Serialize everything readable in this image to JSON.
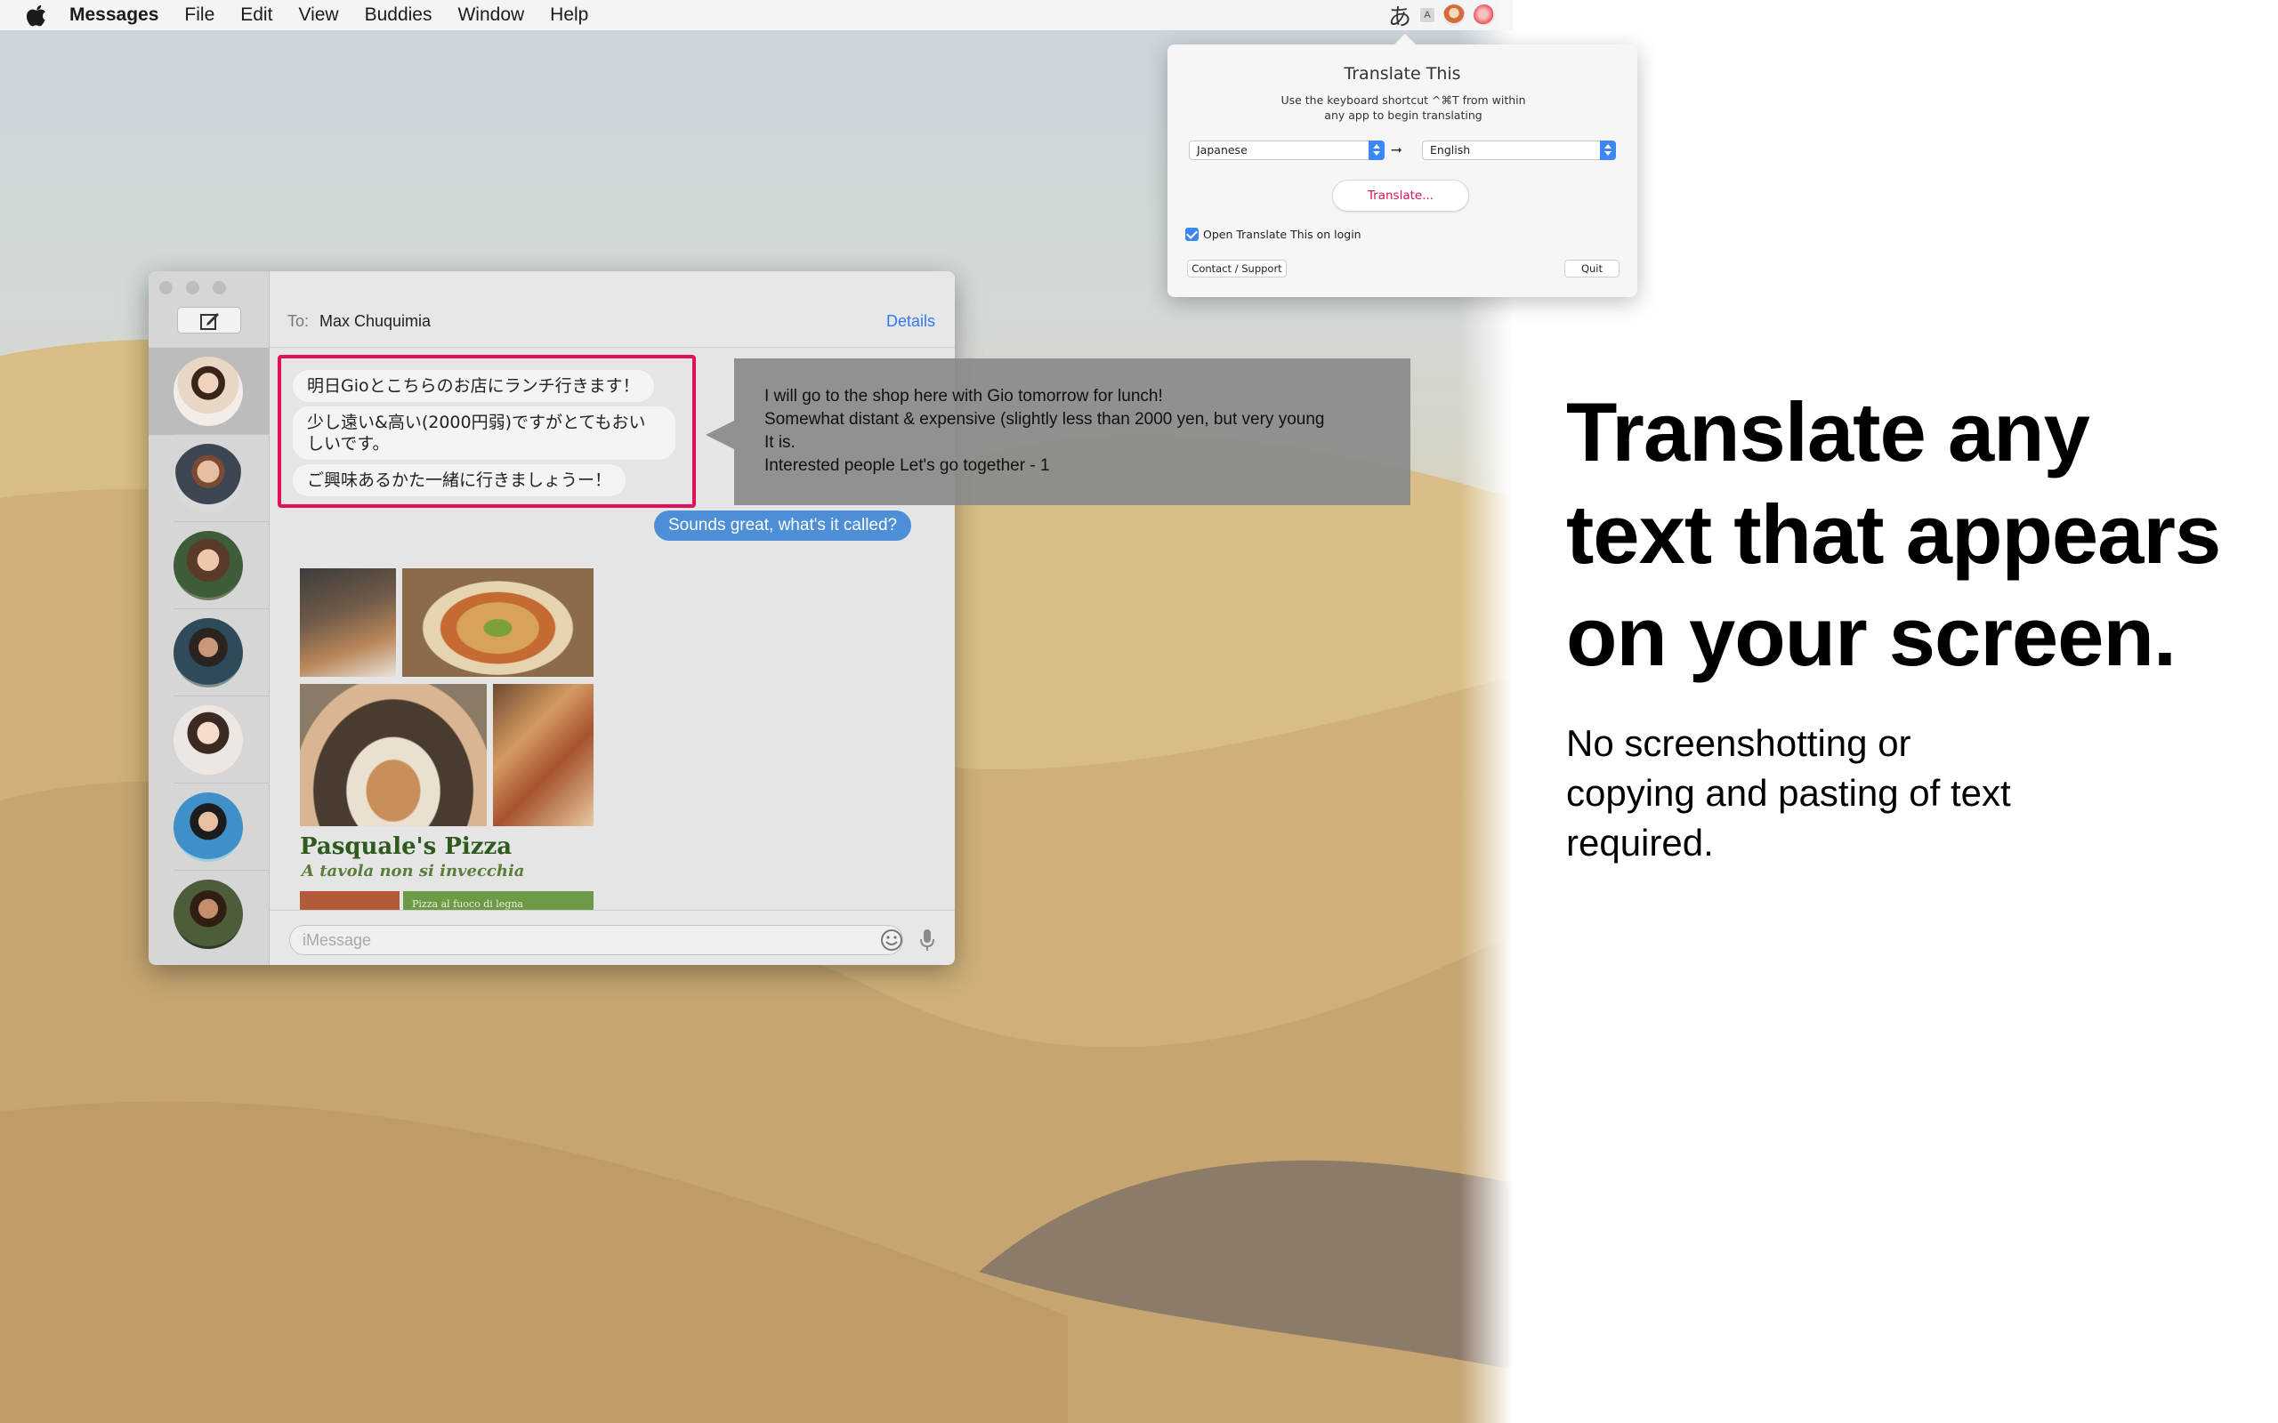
{
  "menubar": {
    "app_name": "Messages",
    "items": [
      "File",
      "Edit",
      "View",
      "Buddies",
      "Window",
      "Help"
    ],
    "status_glyph": "あ",
    "status_small_label": "A"
  },
  "popover": {
    "title": "Translate This",
    "description": "Use the keyboard shortcut ^⌘T from within any app to begin translating",
    "source_language": "Japanese",
    "target_language": "English",
    "swap_symbol": "⭢",
    "translate_button": "Translate...",
    "login_checkbox_label": "Open Translate This on login",
    "login_checkbox_checked": true,
    "contact_button": "Contact / Support",
    "quit_button": "Quit"
  },
  "messages": {
    "to_label": "To:",
    "recipient": "Max Chuquimia",
    "details_link": "Details",
    "incoming_japanese": [
      "明日Gioとこちらのお店にランチ行きます！",
      "少し遠い&高い(2000円弱)ですがとてもおい",
      "しいです。",
      "ご興味あるかた一緒に行きましょうー！"
    ],
    "sent_message": "Sounds great, what's it called?",
    "pizza_name": "Pasquale's Pizza",
    "pizza_tagline": "A tavola non si invecchia",
    "pizza_banner": "Pizza al fuoco di legna",
    "input_placeholder": "iMessage"
  },
  "translation": {
    "lines": [
      "I will go to the shop here with Gio tomorrow for lunch!",
      "Somewhat distant & expensive (slightly less than 2000 yen, but very young",
      "It is.",
      "Interested people Let's go together - 1"
    ]
  },
  "marketing": {
    "headline_lines": [
      "Translate any",
      "text that appears",
      "on your screen."
    ],
    "subline_lines": [
      "No screenshotting or",
      "copying and pasting of text",
      "required."
    ]
  },
  "colors": {
    "accent_blue": "#3478f6",
    "highlight_pink": "#e0115a",
    "sent_bubble": "#4c8fd6"
  }
}
